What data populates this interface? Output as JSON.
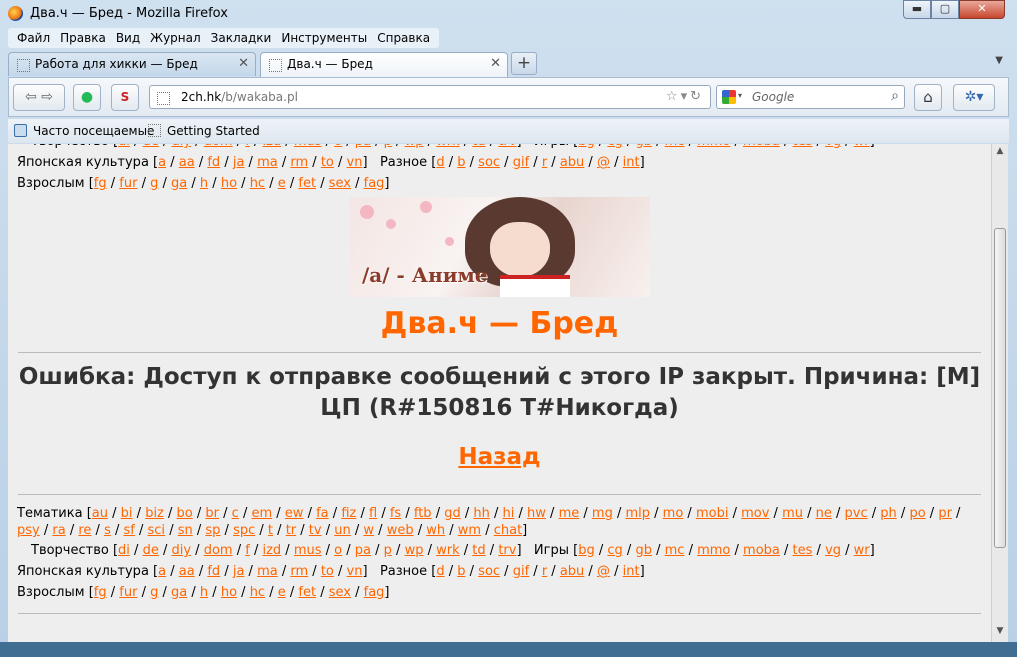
{
  "window": {
    "title": "Два.ч — Бред - Mozilla Firefox",
    "controls": {
      "minimize": "▬",
      "maximize": "▢",
      "close": "✕"
    }
  },
  "menu": [
    "Файл",
    "Правка",
    "Вид",
    "Журнал",
    "Закладки",
    "Инструменты",
    "Справка"
  ],
  "tabs": [
    {
      "label": "Работа для хикки — Бред",
      "active": false
    },
    {
      "label": "Два.ч — Бред",
      "active": true
    }
  ],
  "tab_close": "✕",
  "new_tab": "+",
  "address": {
    "host": "2ch.hk",
    "path": "/b/wakaba.pl"
  },
  "search": {
    "placeholder": "Google"
  },
  "bookmarks": [
    "Часто посещаемые",
    "Getting Started"
  ],
  "boards": {
    "Тематика": [
      "au",
      "bi",
      "biz",
      "bo",
      "br",
      "c",
      "em",
      "ew",
      "fa",
      "fiz",
      "fl",
      "fs",
      "ftb",
      "gd",
      "hh",
      "hi",
      "hw",
      "me",
      "mg",
      "mlp",
      "mo",
      "mobi",
      "mov",
      "mu",
      "ne",
      "pvc",
      "ph",
      "po",
      "pr",
      "psy",
      "ra",
      "re",
      "s",
      "sf",
      "sci",
      "sn",
      "sp",
      "spc",
      "t",
      "tr",
      "tv",
      "un",
      "w",
      "web",
      "wh",
      "wm",
      "chat"
    ],
    "Творчество": [
      "di",
      "de",
      "diy",
      "dom",
      "f",
      "izd",
      "mus",
      "o",
      "pa",
      "p",
      "wp",
      "wrk",
      "td",
      "trv"
    ],
    "Игры": [
      "bg",
      "cg",
      "gb",
      "mc",
      "mmo",
      "moba",
      "tes",
      "vg",
      "wr"
    ],
    "Японская культура": [
      "a",
      "aa",
      "fd",
      "ja",
      "ma",
      "rm",
      "to",
      "vn"
    ],
    "Разное": [
      "d",
      "b",
      "soc",
      "gif",
      "r",
      "abu",
      "@",
      "int"
    ],
    "Взрослым": [
      "fg",
      "fur",
      "g",
      "ga",
      "h",
      "ho",
      "hc",
      "e",
      "fet",
      "sex",
      "fag"
    ]
  },
  "labels": {
    "topics": "Тематика",
    "creative": "Творчество",
    "games": "Игры",
    "japan": "Японская культура",
    "misc": "Разное",
    "adult": "Взрослым"
  },
  "banner_caption": "/a/ - Аниме",
  "logo": "Два.ч — Бред",
  "error_text": "Ошибка: Доступ к отправке сообщений с этого IP закрыт. Причина: [M] ЦП (R#150816 T#Никогда)",
  "back_link": "Назад",
  "colors": {
    "link": "#ff6600",
    "background": "#eeeeee",
    "heading": "#333333"
  }
}
